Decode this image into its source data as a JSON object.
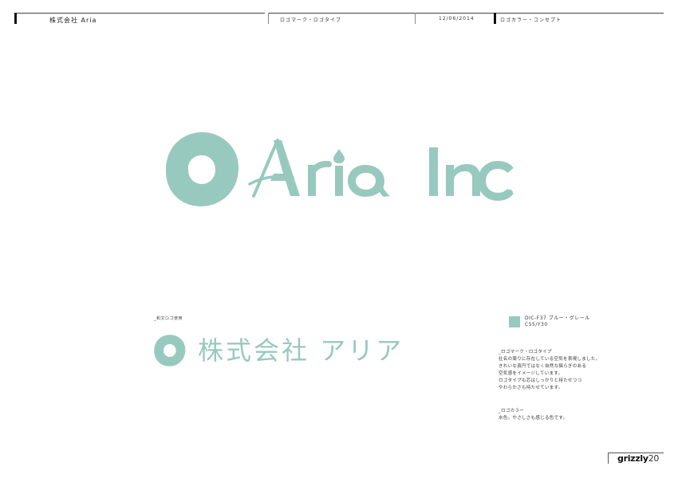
{
  "header": {
    "company": "株式会社 Aria",
    "section": "ロゴマーク・ロゴタイプ",
    "date": "12/06/2014",
    "topic": "ロゴカラー・コンセプト"
  },
  "logo": {
    "wordmark": "Aria Inc.",
    "color": "#98c9bf"
  },
  "japanese_logo": {
    "caption": "_和文ロゴ使用",
    "text": "株式会社 アリア"
  },
  "color_spec": {
    "line1": "DIC-F37 ブルー・グレール",
    "line2": "C55/Y30"
  },
  "concept": {
    "title": "_ロゴマーク・ロゴタイプ",
    "lines": [
      "社名の周りに存在している空気を表現しました。",
      "きれいな真円ではなく自然な揺らぎのある",
      "空気感をイメージしています。",
      "ロゴタイプも芯はしっかりと持たせつつ",
      "やわらかさも持たせています。"
    ]
  },
  "color_concept": {
    "title": "_ロゴカラー",
    "line": "水色。やさしさも感じる色です。"
  },
  "footer": {
    "brand": "grizzly",
    "page": "20"
  }
}
